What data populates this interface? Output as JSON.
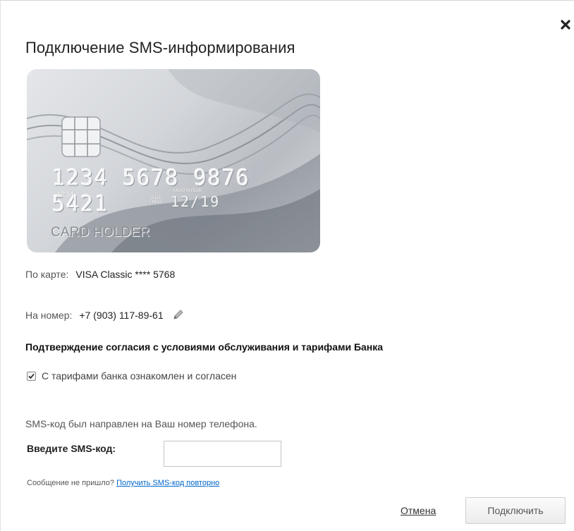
{
  "dialog": {
    "title": "Подключение SMS-информирования",
    "close_icon": "close-icon"
  },
  "card": {
    "number": "1234 5678 9876 5421",
    "small_number": "1234",
    "month_year_label": "MONTH/YEAR",
    "valid_thru": "VALID THRU",
    "expiry": "12/19",
    "holder": "CARD HOLDER"
  },
  "card_info": {
    "label": "По карте:",
    "value": "VISA Classic **** 5768"
  },
  "phone_info": {
    "label": "На номер:",
    "value": "+7 (903) 117-89-61",
    "edit_icon": "pencil-icon"
  },
  "agreement": {
    "heading": "Подтверждение согласия с условиями обслуживания и тарифами Банка",
    "checkbox_label": "С тарифами банка ознакомлен и согласен",
    "checked": true
  },
  "sms": {
    "info": "SMS-код был направлен на Ваш номер телефона.",
    "input_label": "Введите SMS-код:",
    "input_value": "",
    "resend_text": "Сообщение не пришло?",
    "resend_link": "Получить SMS-код повторно"
  },
  "actions": {
    "cancel": "Отмена",
    "connect": "Подключить"
  }
}
